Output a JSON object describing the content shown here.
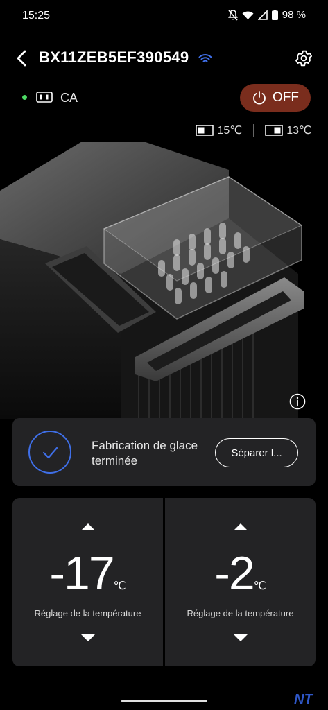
{
  "status_bar": {
    "time": "15:25",
    "battery": "98 %"
  },
  "header": {
    "title": "BX11ZEB5EF390549"
  },
  "power": {
    "source_label": "CA",
    "button_label": "OFF"
  },
  "zones": {
    "left_temp": "15℃",
    "right_temp": "13℃"
  },
  "notification": {
    "message": "Fabrication de glace terminée",
    "action_label": "Séparer l..."
  },
  "panels": {
    "left": {
      "temperature": "-17",
      "unit": "℃",
      "label": "Réglage de la température"
    },
    "right": {
      "temperature": "-2",
      "unit": "℃",
      "label": "Réglage de la température"
    }
  },
  "watermark": "NT"
}
